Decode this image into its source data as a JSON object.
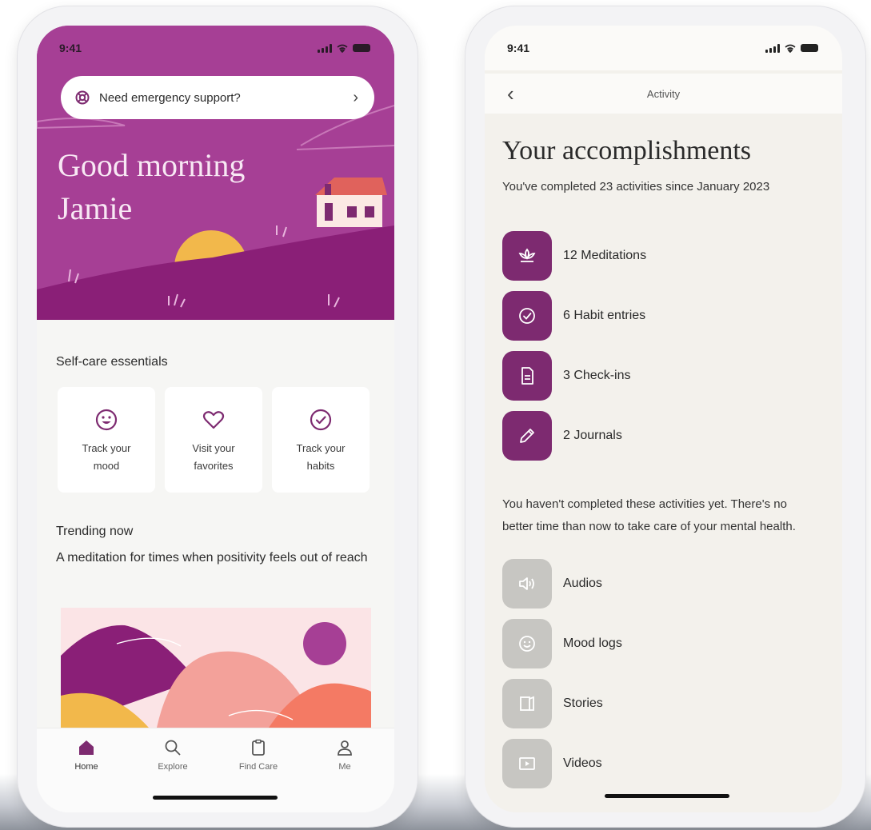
{
  "left": {
    "status": {
      "time": "9:41"
    },
    "emergency": {
      "label": "Need emergency support?"
    },
    "greeting": {
      "line1": "Good morning",
      "line2": "Jamie"
    },
    "self_care": {
      "title": "Self-care essentials",
      "cards": [
        {
          "icon": "smiley-icon",
          "line1": "Track your",
          "line2": "mood"
        },
        {
          "icon": "heart-icon",
          "line1": "Visit your",
          "line2": "favorites"
        },
        {
          "icon": "check-circle-icon",
          "line1": "Track your",
          "line2": "habits"
        }
      ]
    },
    "trending": {
      "title": "Trending now",
      "subtitle": "A meditation for times when positivity feels out of reach"
    },
    "tabs": [
      {
        "icon": "home-icon",
        "label": "Home"
      },
      {
        "icon": "search-icon",
        "label": "Explore"
      },
      {
        "icon": "clipboard-icon",
        "label": "Find Care"
      },
      {
        "icon": "person-icon",
        "label": "Me"
      }
    ]
  },
  "right": {
    "status": {
      "time": "9:41"
    },
    "nav": {
      "title": "Activity"
    },
    "title": "Your accomplishments",
    "subtitle": "You've completed 23 activities since January 2023",
    "completed": [
      {
        "icon": "lotus-icon",
        "label": "12 Meditations"
      },
      {
        "icon": "check-circle-icon",
        "label": "6 Habit entries"
      },
      {
        "icon": "document-icon",
        "label": "3 Check-ins"
      },
      {
        "icon": "pencil-icon",
        "label": "2 Journals"
      }
    ],
    "not_completed_text": "You haven't completed these activities yet. There's no better time than now to take care of your mental health.",
    "not_completed": [
      {
        "icon": "speaker-icon",
        "label": "Audios"
      },
      {
        "icon": "mood-icon",
        "label": "Mood logs"
      },
      {
        "icon": "book-icon",
        "label": "Stories"
      },
      {
        "icon": "video-icon",
        "label": "Videos"
      }
    ]
  },
  "colors": {
    "hero": "#a63f95",
    "hill": "#8a1f77",
    "badge_active": "#7d2a70",
    "badge_inactive": "#c7c6c2"
  }
}
